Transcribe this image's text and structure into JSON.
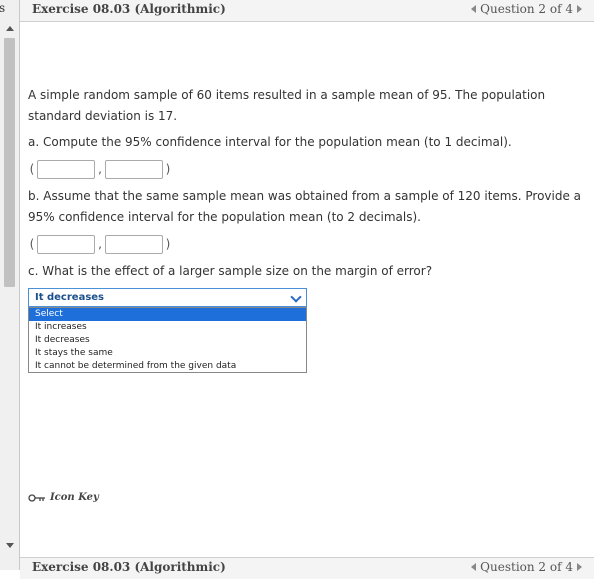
{
  "left_strip": {
    "tab_label": "s"
  },
  "header": {
    "title": "Exercise 08.03 (Algorithmic)",
    "question_nav": "Question 2 of 4"
  },
  "problem": {
    "intro": "A simple random sample of 60 items resulted in a sample mean of 95. The population standard deviation is 17.",
    "part_a": "a. Compute the 95% confidence interval for the population mean (to 1 decimal).",
    "part_b": "b. Assume that the same sample mean was obtained from a sample of 120 items. Provide a 95% confidence interval for the population mean (to 2 decimals).",
    "part_c": "c. What is the effect of a larger sample size on the margin of error?",
    "open_paren": "(",
    "comma": ",",
    "close_paren": ")"
  },
  "part_a_inputs": {
    "lower": "",
    "upper": ""
  },
  "part_b_inputs": {
    "lower": "",
    "upper": ""
  },
  "part_c_select": {
    "selected": "It decreases",
    "options": [
      "Select",
      "It increases",
      "It decreases",
      "It stays the same",
      "It cannot be determined from the given data"
    ],
    "highlighted_option": "Select"
  },
  "icon_key": {
    "label": "Icon Key"
  },
  "footer": {
    "title": "Exercise 08.03 (Algorithmic)",
    "question_nav": "Question 2 of 4"
  },
  "colors": {
    "accent": "#1e6fd9",
    "select_border": "#4a90d9"
  }
}
